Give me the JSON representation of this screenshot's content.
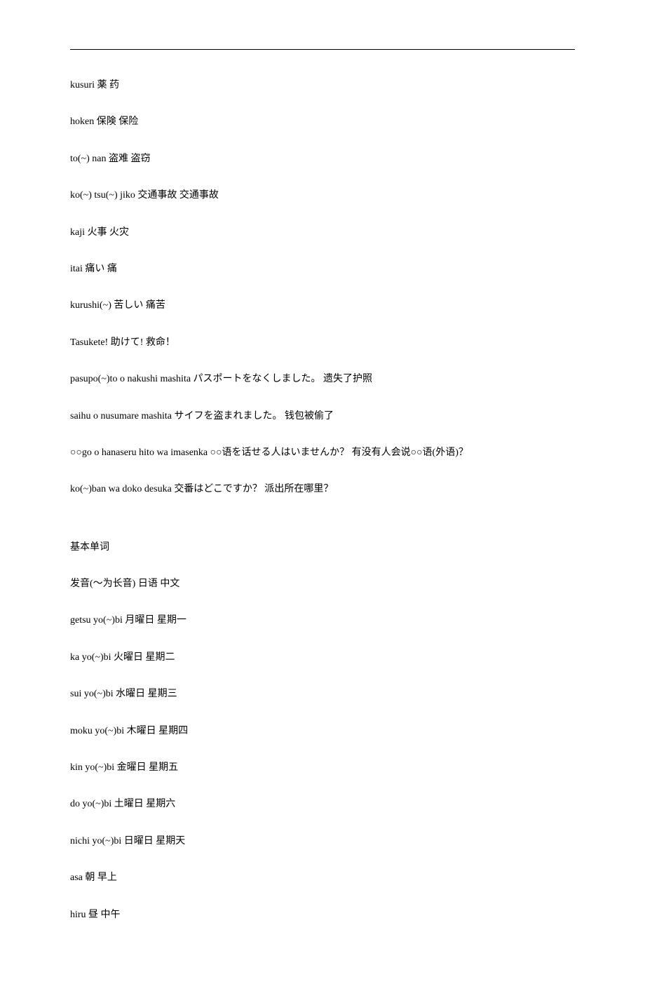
{
  "entries_top": [
    "kusuri  薬  药",
    "hoken  保険  保险",
    "to(~) nan  盗难  盗窃",
    "ko(~) tsu(~) jiko  交通事故  交通事故",
    "kaji  火事  火灾",
    "itai  痛い  痛",
    "kurushi(~)  苦しい  痛苦",
    "Tasukete!  助けて!    救命！",
    "pasupo(~)to o nakushi mashita  パスポートをなくしました。  遗失了护照",
    "saihu o nusumare mashita  サイフを盗まれました。  钱包被偷了",
    "○○go o hanaseru hito wa imasenka  ○○语を话せる人はいませんか？   有没有人会说○○语(外语)？",
    "ko(~)ban wa doko desuka  交番はどこですか？   派出所在哪里？"
  ],
  "section_header": "基本单词",
  "pronunciation_header": "发音(～为长音)  日语  中文",
  "entries_bottom": [
    "getsu yo(~)bi  月曜日  星期一",
    "ka yo(~)bi  火曜日  星期二",
    "sui yo(~)bi  水曜日  星期三",
    "moku yo(~)bi  木曜日  星期四",
    "kin yo(~)bi  金曜日  星期五",
    "do yo(~)bi  土曜日  星期六",
    "nichi yo(~)bi  日曜日  星期天",
    "asa  朝  早上",
    "hiru  昼  中午"
  ]
}
